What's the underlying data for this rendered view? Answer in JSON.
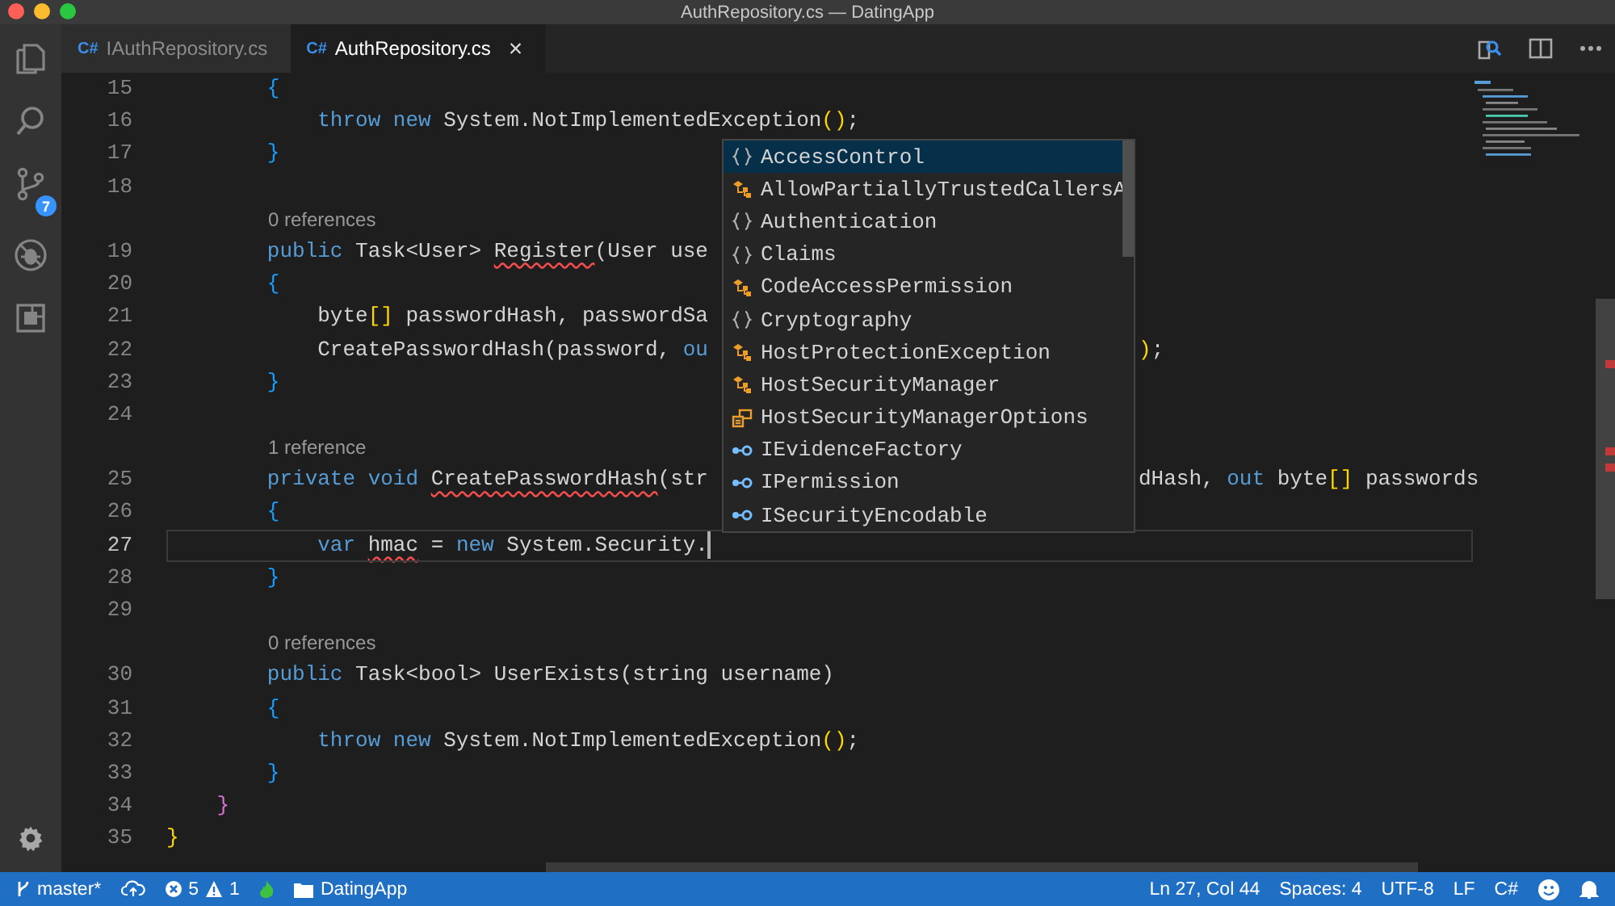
{
  "window": {
    "title": "AuthRepository.cs — DatingApp"
  },
  "activity_bar": {
    "source_control_badge": "7"
  },
  "tabs": [
    {
      "label": "IAuthRepository.cs",
      "language": "C#",
      "selected": false
    },
    {
      "label": "AuthRepository.cs",
      "language": "C#",
      "selected": true,
      "close": "×"
    }
  ],
  "editor": {
    "lines": [
      {
        "kind": "code",
        "number": "15",
        "active": false,
        "tokens": [
          {
            "text": "        {",
            "kind": "bracket-blue"
          }
        ]
      },
      {
        "kind": "code",
        "number": "16",
        "active": false,
        "tokens": [
          {
            "text": "            throw new",
            "kind": "keyword"
          },
          {
            "text": " System.NotImplementedException",
            "kind": "plain"
          },
          {
            "text": "()",
            "kind": "bracket-yellow"
          },
          {
            "text": ";",
            "kind": "plain"
          }
        ]
      },
      {
        "kind": "code",
        "number": "17",
        "active": false,
        "tokens": [
          {
            "text": "        }",
            "kind": "bracket-blue"
          }
        ]
      },
      {
        "kind": "code",
        "number": "18",
        "active": false
      },
      {
        "kind": "codelens",
        "text": "0 references"
      },
      {
        "kind": "code",
        "number": "19",
        "active": false,
        "tokens": [
          {
            "text": "        public",
            "kind": "keyword"
          },
          {
            "text": " Task<User> ",
            "kind": "plain"
          },
          {
            "text": "Register",
            "kind": "plain",
            "error": true
          },
          {
            "text": "(User use",
            "kind": "plain"
          }
        ]
      },
      {
        "kind": "code",
        "number": "20",
        "active": false,
        "tokens": [
          {
            "text": "        {",
            "kind": "bracket-blue"
          }
        ]
      },
      {
        "kind": "code",
        "number": "21",
        "active": false,
        "tokens": [
          {
            "text": "            byte",
            "kind": "plain"
          },
          {
            "text": "[]",
            "kind": "bracket-yellow"
          },
          {
            "text": " passwordHash, passwordSa",
            "kind": "plain"
          }
        ]
      },
      {
        "kind": "code",
        "number": "22",
        "active": false,
        "tokens": [
          {
            "text": "            CreatePasswordHash(password, ",
            "kind": "plain"
          },
          {
            "text": "ou",
            "kind": "keyword"
          }
        ],
        "after_popup": [
          {
            "text": ")",
            "kind": "bracket-yellow"
          },
          {
            "text": ";",
            "kind": "plain"
          }
        ]
      },
      {
        "kind": "code",
        "number": "23",
        "active": false,
        "tokens": [
          {
            "text": "        }",
            "kind": "bracket-blue"
          }
        ]
      },
      {
        "kind": "code",
        "number": "24",
        "active": false
      },
      {
        "kind": "codelens",
        "text": "1 reference"
      },
      {
        "kind": "code",
        "number": "25",
        "active": false,
        "tokens": [
          {
            "text": "        private void ",
            "kind": "keyword"
          },
          {
            "text": "CreatePasswordHash",
            "kind": "plain",
            "error": true
          },
          {
            "text": "(str",
            "kind": "plain"
          }
        ],
        "after_popup": [
          {
            "text": "dHash, ",
            "kind": "plain"
          },
          {
            "text": "out",
            "kind": "keyword"
          },
          {
            "text": " byte",
            "kind": "plain"
          },
          {
            "text": "[]",
            "kind": "bracket-yellow"
          },
          {
            "text": " passwords",
            "kind": "plain"
          }
        ]
      },
      {
        "kind": "code",
        "number": "26",
        "active": false,
        "tokens": [
          {
            "text": "        {",
            "kind": "bracket-blue"
          }
        ]
      },
      {
        "kind": "code",
        "number": "27",
        "active": true,
        "tokens": [
          {
            "text": "            var ",
            "kind": "keyword"
          },
          {
            "text": "hmac",
            "kind": "plain",
            "error": true
          },
          {
            "text": " = ",
            "kind": "plain"
          },
          {
            "text": "new",
            "kind": "keyword"
          },
          {
            "text": " System.Security.",
            "kind": "plain"
          }
        ]
      },
      {
        "kind": "code",
        "number": "28",
        "active": false,
        "tokens": [
          {
            "text": "        }",
            "kind": "bracket-blue"
          }
        ]
      },
      {
        "kind": "code",
        "number": "29",
        "active": false
      },
      {
        "kind": "codelens",
        "text": "0 references"
      },
      {
        "kind": "code",
        "number": "30",
        "active": false,
        "tokens": [
          {
            "text": "        public",
            "kind": "keyword"
          },
          {
            "text": " Task<bool> UserExists(string username)",
            "kind": "plain"
          }
        ]
      },
      {
        "kind": "code",
        "number": "31",
        "active": false,
        "tokens": [
          {
            "text": "        {",
            "kind": "bracket-blue"
          }
        ]
      },
      {
        "kind": "code",
        "number": "32",
        "active": false,
        "tokens": [
          {
            "text": "            throw new",
            "kind": "keyword"
          },
          {
            "text": " System.NotImplementedException",
            "kind": "plain"
          },
          {
            "text": "()",
            "kind": "bracket-yellow"
          },
          {
            "text": ";",
            "kind": "plain"
          }
        ]
      },
      {
        "kind": "code",
        "number": "33",
        "active": false,
        "tokens": [
          {
            "text": "        }",
            "kind": "bracket-blue"
          }
        ]
      },
      {
        "kind": "code",
        "number": "34",
        "active": false,
        "tokens": [
          {
            "text": "    }",
            "kind": "bracket-magenta"
          }
        ]
      },
      {
        "kind": "code",
        "number": "35",
        "active": false,
        "tokens": [
          {
            "text": "}",
            "kind": "bracket-yellow"
          }
        ]
      }
    ]
  },
  "suggestions": [
    {
      "label": "AccessControl",
      "kind": "namespace",
      "selected": true
    },
    {
      "label": "AllowPartiallyTrustedCallersA",
      "kind": "class",
      "selected": false
    },
    {
      "label": "Authentication",
      "kind": "namespace",
      "selected": false
    },
    {
      "label": "Claims",
      "kind": "namespace",
      "selected": false
    },
    {
      "label": "CodeAccessPermission",
      "kind": "class",
      "selected": false
    },
    {
      "label": "Cryptography",
      "kind": "namespace",
      "selected": false
    },
    {
      "label": "HostProtectionException",
      "kind": "class",
      "selected": false
    },
    {
      "label": "HostSecurityManager",
      "kind": "class",
      "selected": false
    },
    {
      "label": "HostSecurityManagerOptions",
      "kind": "enum",
      "selected": false
    },
    {
      "label": "IEvidenceFactory",
      "kind": "interface",
      "selected": false
    },
    {
      "label": "IPermission",
      "kind": "interface",
      "selected": false
    },
    {
      "label": "ISecurityEncodable",
      "kind": "interface",
      "selected": false
    }
  ],
  "status_bar": {
    "branch": "master*",
    "errors": "5",
    "warnings": "1",
    "folder": "DatingApp",
    "right": [
      "Ln 27, Col 44",
      "Spaces: 4",
      "UTF-8",
      "LF",
      "C#"
    ]
  }
}
